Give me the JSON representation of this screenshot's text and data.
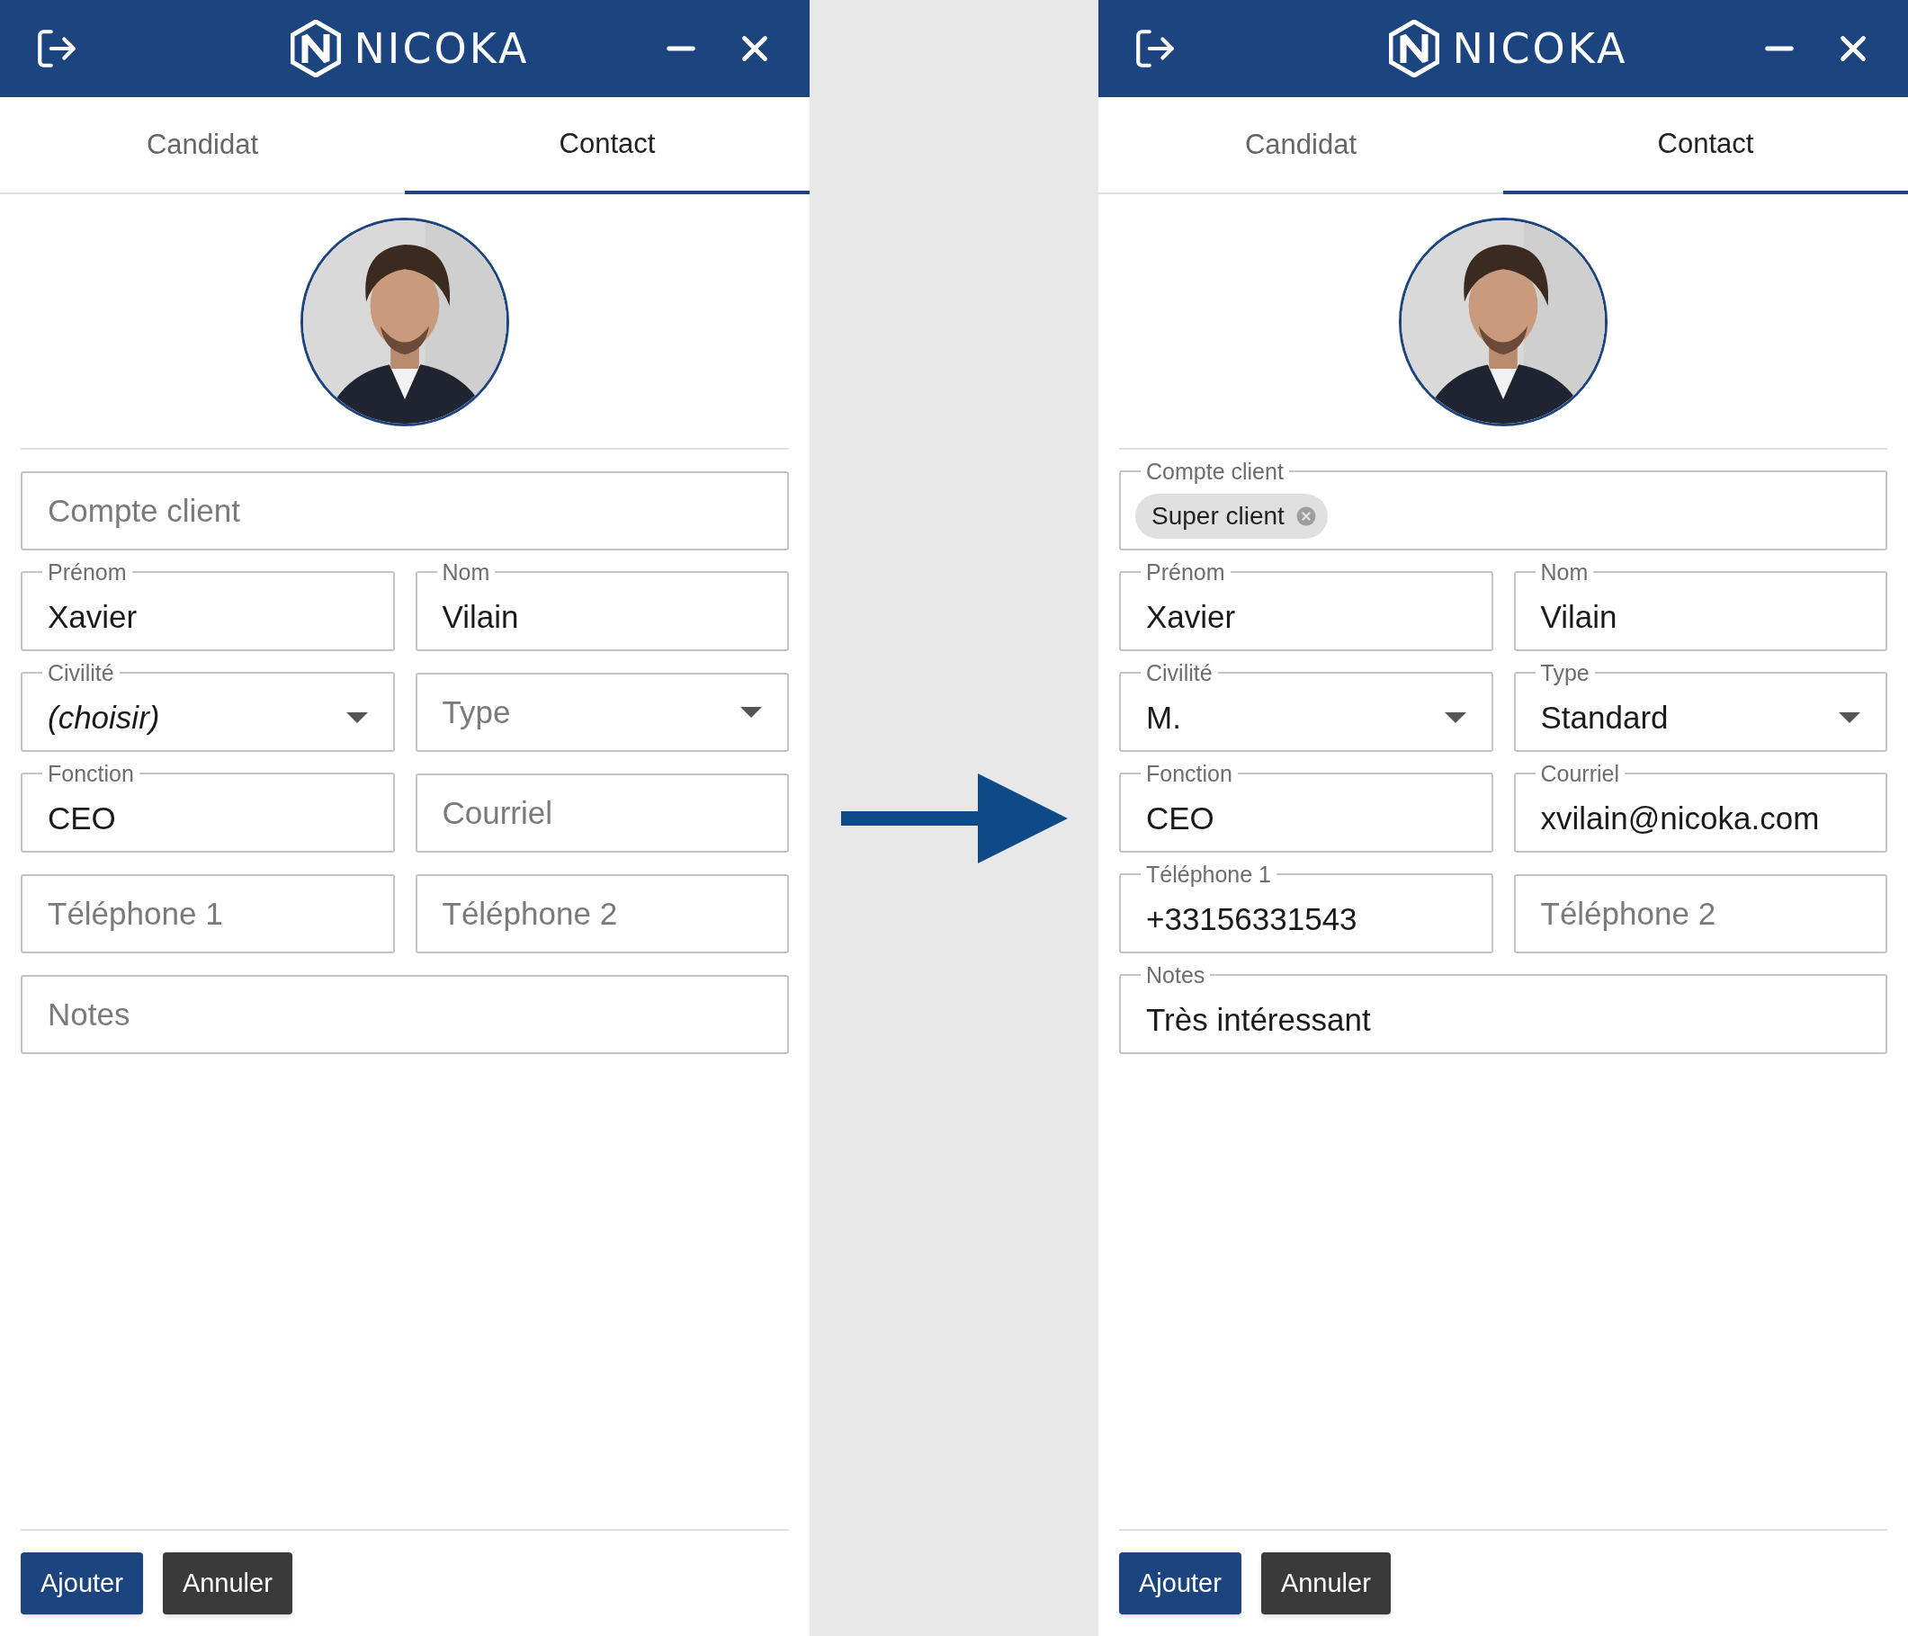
{
  "panels": [
    {
      "header": {
        "title": "NICOKA"
      },
      "tabs": [
        {
          "label": "Candidat",
          "selected": false
        },
        {
          "label": "Contact",
          "selected": true
        }
      ],
      "avatar": {
        "kind": "picture"
      },
      "rows": [
        [
          {
            "kind": "text",
            "placeholder": "Compte client"
          }
        ],
        [
          {
            "kind": "text",
            "label": "Prénom",
            "value": "Xavier"
          },
          {
            "kind": "text",
            "label": "Nom",
            "value": "Vilain"
          }
        ],
        [
          {
            "kind": "select",
            "label": "Civilité",
            "value": "(choisir)",
            "italic": true
          },
          {
            "kind": "select",
            "placeholder": "Type"
          }
        ],
        [
          {
            "kind": "text",
            "label": "Fonction",
            "value": "CEO"
          },
          {
            "kind": "text",
            "placeholder": "Courriel"
          }
        ],
        [
          {
            "kind": "text",
            "placeholder": "Téléphone 1"
          },
          {
            "kind": "text",
            "placeholder": "Téléphone 2"
          }
        ],
        [
          {
            "kind": "text",
            "placeholder": "Notes"
          }
        ]
      ],
      "buttons": [
        {
          "label": "Ajouter",
          "kind": "primary"
        },
        {
          "label": "Annuler",
          "kind": "secondary"
        }
      ]
    },
    {
      "header": {
        "title": "NICOKA"
      },
      "tabs": [
        {
          "label": "Candidat",
          "selected": false
        },
        {
          "label": "Contact",
          "selected": true
        }
      ],
      "avatar": {
        "kind": "picture"
      },
      "rows": [
        [
          {
            "kind": "chips",
            "label": "Compte client",
            "chips": [
              "Super client"
            ]
          }
        ],
        [
          {
            "kind": "text",
            "label": "Prénom",
            "value": "Xavier"
          },
          {
            "kind": "text",
            "label": "Nom",
            "value": "Vilain"
          }
        ],
        [
          {
            "kind": "select",
            "label": "Civilité",
            "value": "M.",
            "italic": false
          },
          {
            "kind": "select",
            "label": "Type",
            "value": "Standard",
            "italic": false
          }
        ],
        [
          {
            "kind": "text",
            "label": "Fonction",
            "value": "CEO"
          },
          {
            "kind": "text",
            "label": "Courriel",
            "value": "xvilain@nicoka.com"
          }
        ],
        [
          {
            "kind": "text",
            "label": "Téléphone 1",
            "value": "+33156331543"
          },
          {
            "kind": "text",
            "placeholder": "Téléphone 2"
          }
        ],
        [
          {
            "kind": "text",
            "label": "Notes",
            "value": "Très intéressant"
          }
        ]
      ],
      "buttons": [
        {
          "label": "Ajouter",
          "kind": "primary"
        },
        {
          "label": "Annuler",
          "kind": "secondary"
        }
      ]
    }
  ]
}
